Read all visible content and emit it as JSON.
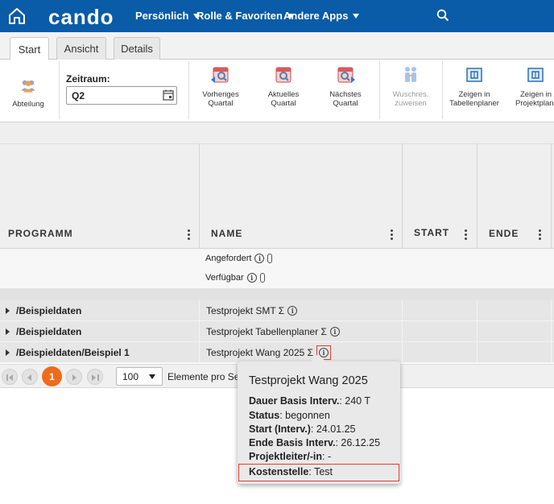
{
  "topbar": {
    "logo": "cando",
    "nav": [
      "Persönlich",
      "Rolle & Favoriten",
      "Andere Apps"
    ]
  },
  "tabs": [
    "Start",
    "Ansicht",
    "Details"
  ],
  "ribbon": {
    "abteilung": "Abteilung",
    "zeitraum_label": "Zeitraum:",
    "zeitraum_value": "Q2",
    "prev_quarter": [
      "Vorheriges",
      "Quartal"
    ],
    "curr_quarter": [
      "Aktuelles",
      "Quartal"
    ],
    "next_quarter": [
      "Nächstes",
      "Quartal"
    ],
    "wunschres": [
      "Wuschres.",
      "zuweisen"
    ],
    "tabellenplaner": [
      "Zeigen in",
      "Tabellenplaner"
    ],
    "projektplaner": [
      "Zeigen in",
      "Projektplane"
    ]
  },
  "grid": {
    "columns": [
      "PROGRAMM",
      "NAME",
      "START",
      "ENDE"
    ],
    "sub_rows": [
      "Angefordert",
      "Verfügbar"
    ],
    "rows": [
      {
        "programm": "/Beispieldaten",
        "name": "Testprojekt SMT Σ"
      },
      {
        "programm": "/Beispieldaten",
        "name": "Testprojekt Tabellenplaner Σ"
      },
      {
        "programm": "/Beispieldaten/Beispiel 1",
        "name": "Testprojekt Wang 2025 Σ"
      }
    ]
  },
  "pager": {
    "current_page": "1",
    "page_size": "100",
    "label": "Elemente pro Seite"
  },
  "tooltip": {
    "title": "Testprojekt Wang 2025",
    "fields": [
      {
        "label": "Dauer Basis Interv.",
        "value": "240 T"
      },
      {
        "label": "Status",
        "value": "begonnen"
      },
      {
        "label": "Start (Interv.)",
        "value": "24.01.25"
      },
      {
        "label": "Ende Basis Interv.",
        "value": "26.12.25"
      },
      {
        "label": "Projektleiter/-in",
        "value": "-"
      },
      {
        "label": "Kostenstelle",
        "value": "Test"
      }
    ]
  },
  "colors": {
    "topbar": "#0a5ba8",
    "accent_orange": "#f06a1c",
    "highlight_red": "#e23b2e"
  }
}
